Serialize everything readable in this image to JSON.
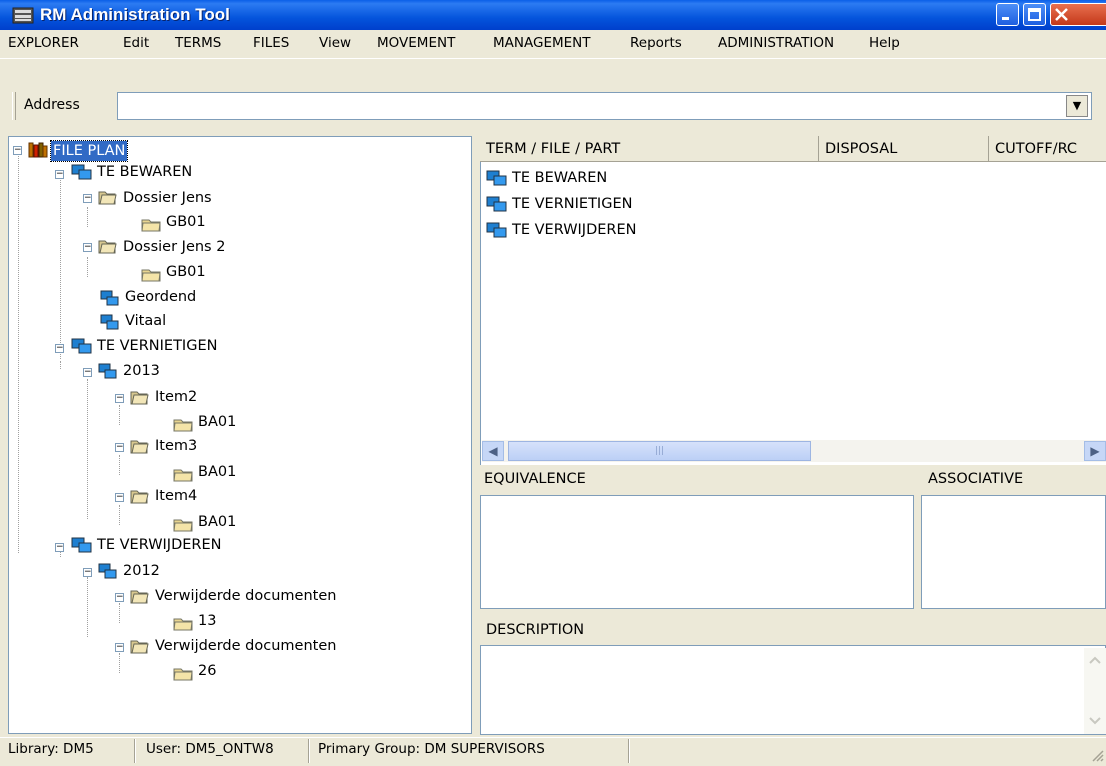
{
  "window": {
    "title": "RM Administration Tool"
  },
  "menu": [
    "EXPLORER",
    "Edit",
    "TERMS",
    "FILES",
    "View",
    "MOVEMENT",
    "MANAGEMENT",
    "Reports",
    "ADMINISTRATION",
    "Help"
  ],
  "address": {
    "label": "Address",
    "value": ""
  },
  "tree": {
    "root": "FILE PLAN",
    "nodes": [
      "TE BEWAREN",
      "Dossier Jens",
      "GB01",
      "Dossier Jens 2",
      "GB01",
      "Geordend",
      "Vitaal",
      "TE VERNIETIGEN",
      "2013",
      "Item2",
      "BA01",
      "Item3",
      "BA01",
      "Item4",
      "BA01",
      "TE VERWIJDEREN",
      "2012",
      "Verwijderde documenten",
      "13",
      "Verwijderde documenten",
      "26"
    ]
  },
  "list": {
    "columns": [
      "TERM / FILE / PART",
      "DISPOSAL",
      "CUTOFF/RC"
    ],
    "rows": [
      "TE BEWAREN",
      "TE VERNIETIGEN",
      "TE VERWIJDEREN"
    ]
  },
  "panels": {
    "equivalence": "EQUIVALENCE",
    "associative": "ASSOCIATIVE",
    "description": "DESCRIPTION"
  },
  "status": {
    "library": "Library: DM5",
    "user": "User: DM5_ONTW8",
    "group": "Primary Group: DM SUPERVISORS"
  },
  "colors": {
    "titlebar": "#0454DC",
    "selection": "#316AC5",
    "chrome": "#ECE9D8"
  }
}
